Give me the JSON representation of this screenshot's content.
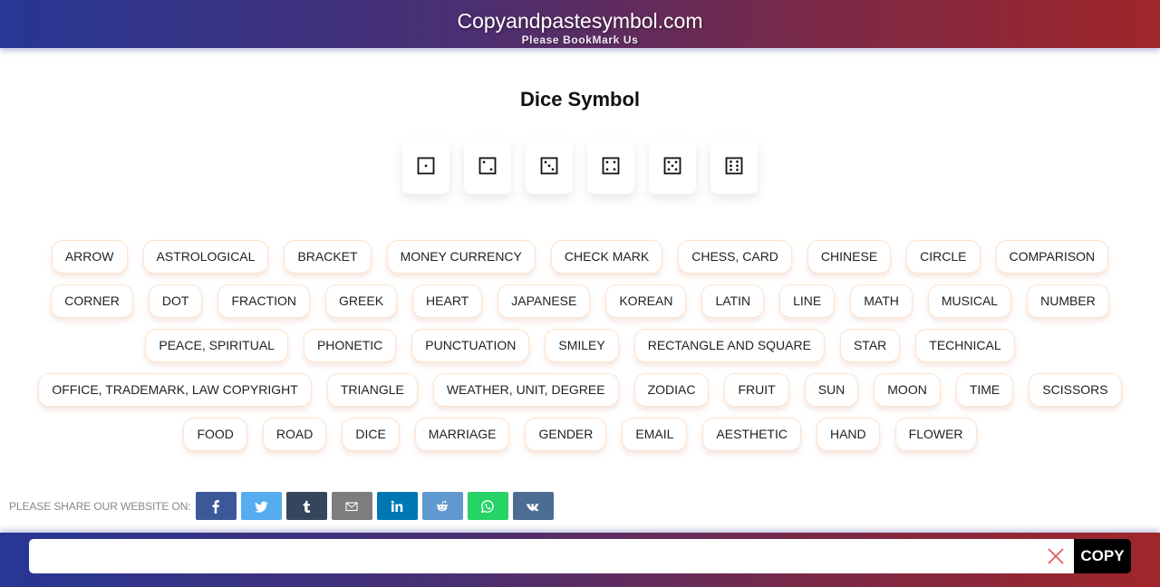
{
  "header": {
    "title": "Copyandpastesymbol.com",
    "subtitle": "Please BookMark Us"
  },
  "page": {
    "title": "Dice Symbol"
  },
  "symbols": [
    {
      "char": "⚀",
      "name": "die-face-1",
      "pips": 1
    },
    {
      "char": "⚁",
      "name": "die-face-2",
      "pips": 2
    },
    {
      "char": "⚂",
      "name": "die-face-3",
      "pips": 3
    },
    {
      "char": "⚃",
      "name": "die-face-4",
      "pips": 4
    },
    {
      "char": "⚄",
      "name": "die-face-5",
      "pips": 5
    },
    {
      "char": "⚅",
      "name": "die-face-6",
      "pips": 6
    }
  ],
  "categories": [
    "ARROW",
    "ASTROLOGICAL",
    "BRACKET",
    "MONEY CURRENCY",
    "CHECK MARK",
    "CHESS, CARD",
    "CHINESE",
    "CIRCLE",
    "COMPARISON",
    "CORNER",
    "DOT",
    "FRACTION",
    "GREEK",
    "HEART",
    "JAPANESE",
    "KOREAN",
    "LATIN",
    "LINE",
    "MATH",
    "MUSICAL",
    "NUMBER",
    "PEACE, SPIRITUAL",
    "PHONETIC",
    "PUNCTUATION",
    "SMILEY",
    "RECTANGLE AND SQUARE",
    "STAR",
    "TECHNICAL",
    "OFFICE, TRADEMARK, LAW COPYRIGHT",
    "TRIANGLE",
    "WEATHER, UNIT, DEGREE",
    "ZODIAC",
    "FRUIT",
    "SUN",
    "MOON",
    "TIME",
    "SCISSORS",
    "FOOD",
    "ROAD",
    "DICE",
    "MARRIAGE",
    "GENDER",
    "EMAIL",
    "AESTHETIC",
    "HAND",
    "FLOWER"
  ],
  "share": {
    "label": "PLEASE SHARE OUR WEBSITE ON:",
    "buttons": [
      {
        "network": "facebook",
        "icon": "facebook-icon",
        "color": "#3b5998"
      },
      {
        "network": "twitter",
        "icon": "twitter-icon",
        "color": "#55acee"
      },
      {
        "network": "tumblr",
        "icon": "tumblr-icon",
        "color": "#35465c"
      },
      {
        "network": "email",
        "icon": "email-icon",
        "color": "#7d7d7d"
      },
      {
        "network": "linkedin",
        "icon": "linkedin-icon",
        "color": "#0077b5"
      },
      {
        "network": "reddit",
        "icon": "reddit-icon",
        "color": "#5f99cf"
      },
      {
        "network": "whatsapp",
        "icon": "whatsapp-icon",
        "color": "#25d366"
      },
      {
        "network": "vk",
        "icon": "vk-icon",
        "color": "#4c6c91"
      }
    ]
  },
  "copybar": {
    "input_value": "",
    "input_placeholder": "",
    "clear_icon": "close-icon",
    "copy_label": "COPY",
    "clear_color": "#e05555"
  },
  "colors": {
    "gradient_start": "#263794",
    "gradient_end": "#a0262a",
    "button_border": "#fde3cc"
  }
}
